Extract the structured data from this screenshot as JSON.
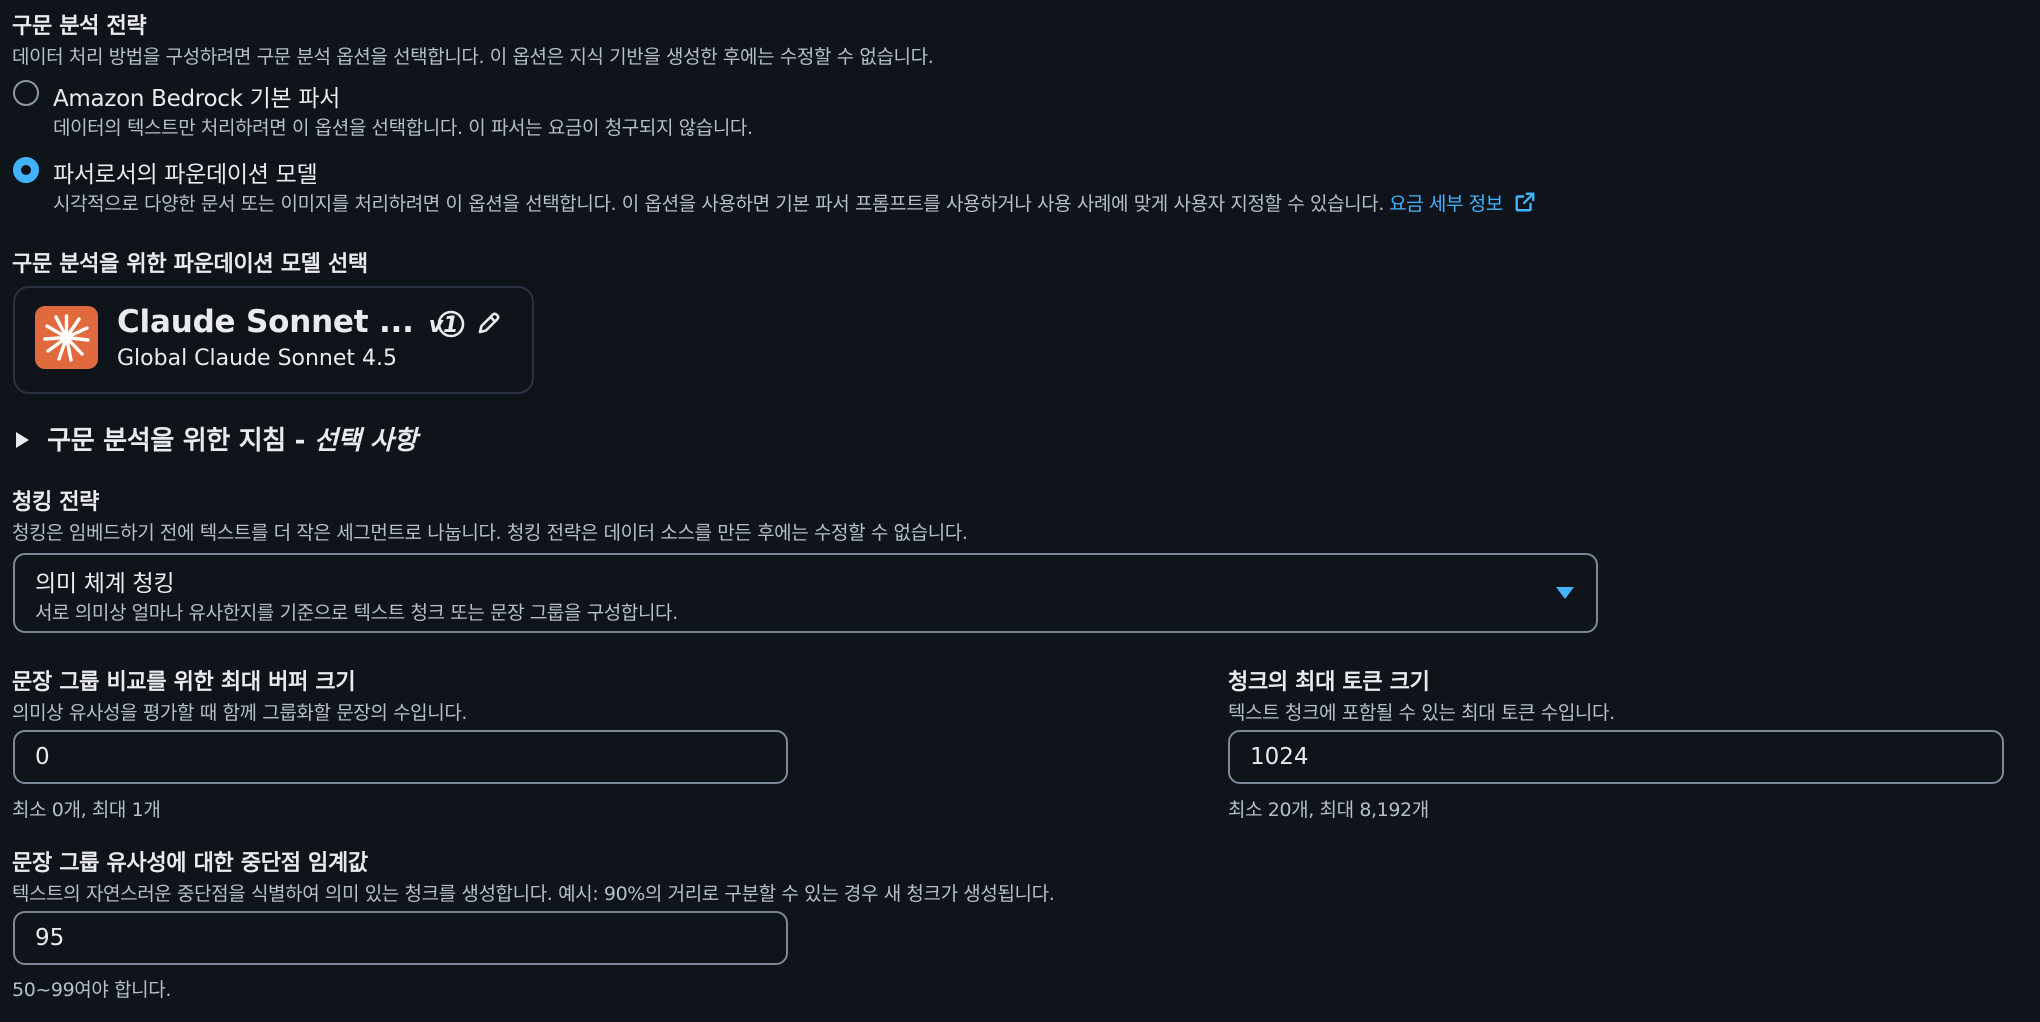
{
  "parsing": {
    "title": "구문 분석 전략",
    "description": "데이터 처리 방법을 구성하려면 구문 분석 옵션을 선택합니다. 이 옵션은 지식 기반을 생성한 후에는 수정할 수 없습니다.",
    "options": [
      {
        "label": "Amazon Bedrock 기본 파서",
        "description": "데이터의 텍스트만 처리하려면 이 옵션을 선택합니다. 이 파서는 요금이 청구되지 않습니다.",
        "selected": false
      },
      {
        "label": "파서로서의 파운데이션 모델",
        "description": "시각적으로 다양한 문서 또는 이미지를 처리하려면 이 옵션을 선택합니다. 이 옵션을 사용하면 기본 파서 프롬프트를 사용하거나 사용 사례에 맞게 사용자 지정할 수 있습니다.",
        "link_label": "요금 세부 정보",
        "selected": true
      }
    ]
  },
  "model_select": {
    "title": "구문 분석을 위한 파운데이션 모델 선택",
    "model_name": "Claude Sonnet ...",
    "model_version": "v1",
    "model_subtitle": "Global Claude Sonnet 4.5",
    "logo_color": "#e06a3e"
  },
  "instructions": {
    "label": "구문 분석을 위한 지침 - ",
    "optional": "선택 사항"
  },
  "chunking": {
    "title": "청킹 전략",
    "description": "청킹은 임베드하기 전에 텍스트를 더 작은 세그먼트로 나눕니다. 청킹 전략은 데이터 소스를 만든 후에는 수정할 수 없습니다.",
    "selected_title": "의미 체계 청킹",
    "selected_description": "서로 의미상 얼마나 유사한지를 기준으로 텍스트 청크 또는 문장 그룹을 구성합니다."
  },
  "buffer": {
    "title": "문장 그룹 비교를 위한 최대 버퍼 크기",
    "description": "의미상 유사성을 평가할 때 함께 그룹화할 문장의 수입니다.",
    "value": "0",
    "hint": "최소 0개, 최대 1개"
  },
  "max_tokens": {
    "title": "청크의 최대 토큰 크기",
    "description": "텍스트 청크에 포함될 수 있는 최대 토큰 수입니다.",
    "value": "1024",
    "hint": "최소 20개, 최대 8,192개"
  },
  "threshold": {
    "title": "문장 그룹 유사성에 대한 중단점 임계값",
    "description": "텍스트의 자연스러운 중단점을 식별하여 의미 있는 청크를 생성합니다. 예시: 90%의 거리로 구분할 수 있는 경우 새 청크가 생성됩니다.",
    "value": "95",
    "hint": "50~99여야 합니다."
  },
  "colors": {
    "background": "#0f141a",
    "accent": "#42b4ff",
    "text": "#e9ebed",
    "muted": "#b6bec9"
  }
}
